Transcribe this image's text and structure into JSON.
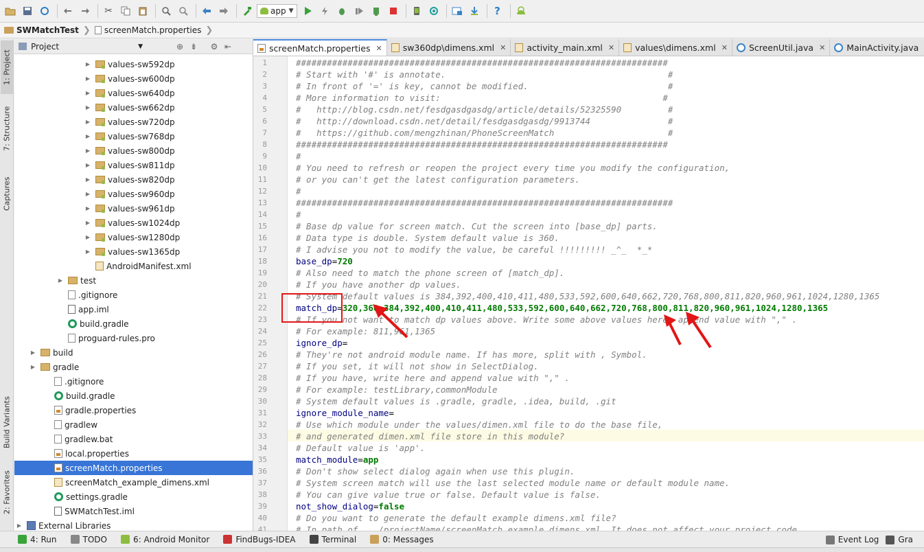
{
  "toolbar": {
    "run_config": "app",
    "icons": [
      "open-folder-icon",
      "save-icon",
      "sync-icon",
      "undo-icon",
      "redo-icon",
      "cut-icon",
      "copy-icon",
      "paste-icon",
      "find-icon",
      "replace-icon",
      "back-icon",
      "forward-icon",
      "build-icon",
      "run-icon",
      "debug-lightning-icon",
      "debug-icon",
      "coverage-icon",
      "profile-icon",
      "stop-icon",
      "avd-manager-icon",
      "sdk-manager-icon",
      "project-structure-icon",
      "sdk-download-icon",
      "help-icon",
      "android-icon"
    ]
  },
  "breadcrumb": {
    "project": "SWMatchTest",
    "file": "screenMatch.properties"
  },
  "left_strip": {
    "tabs": [
      "1: Project",
      "7: Structure",
      "Captures",
      "Build Variants",
      "2: Favorites"
    ]
  },
  "project_panel": {
    "header": "Project",
    "tree": [
      {
        "label": "values-sw592dp",
        "type": "folder-res"
      },
      {
        "label": "values-sw600dp",
        "type": "folder-res"
      },
      {
        "label": "values-sw640dp",
        "type": "folder-res"
      },
      {
        "label": "values-sw662dp",
        "type": "folder-res"
      },
      {
        "label": "values-sw720dp",
        "type": "folder-res"
      },
      {
        "label": "values-sw768dp",
        "type": "folder-res"
      },
      {
        "label": "values-sw800dp",
        "type": "folder-res"
      },
      {
        "label": "values-sw811dp",
        "type": "folder-res"
      },
      {
        "label": "values-sw820dp",
        "type": "folder-res"
      },
      {
        "label": "values-sw960dp",
        "type": "folder-res"
      },
      {
        "label": "values-sw961dp",
        "type": "folder-res"
      },
      {
        "label": "values-sw1024dp",
        "type": "folder-res"
      },
      {
        "label": "values-sw1280dp",
        "type": "folder-res"
      },
      {
        "label": "values-sw1365dp",
        "type": "folder-res"
      },
      {
        "label": "AndroidManifest.xml",
        "type": "manifest"
      },
      {
        "label": "test",
        "type": "folder"
      },
      {
        "label": ".gitignore",
        "type": "file"
      },
      {
        "label": "app.iml",
        "type": "iml"
      },
      {
        "label": "build.gradle",
        "type": "gradle"
      },
      {
        "label": "proguard-rules.pro",
        "type": "file"
      },
      {
        "label": "build",
        "type": "folder"
      },
      {
        "label": "gradle",
        "type": "folder"
      },
      {
        "label": ".gitignore",
        "type": "file"
      },
      {
        "label": "build.gradle",
        "type": "gradle"
      },
      {
        "label": "gradle.properties",
        "type": "props"
      },
      {
        "label": "gradlew",
        "type": "file"
      },
      {
        "label": "gradlew.bat",
        "type": "file"
      },
      {
        "label": "local.properties",
        "type": "props"
      },
      {
        "label": "screenMatch.properties",
        "type": "props"
      },
      {
        "label": "screenMatch_example_dimens.xml",
        "type": "xml"
      },
      {
        "label": "settings.gradle",
        "type": "gradle"
      },
      {
        "label": "SWMatchTest.iml",
        "type": "iml"
      },
      {
        "label": "External Libraries",
        "type": "libs"
      }
    ]
  },
  "editor_tabs": [
    {
      "label": "screenMatch.properties",
      "type": "props"
    },
    {
      "label": "sw360dp\\dimens.xml",
      "type": "xml"
    },
    {
      "label": "activity_main.xml",
      "type": "xml"
    },
    {
      "label": "values\\dimens.xml",
      "type": "xml"
    },
    {
      "label": "ScreenUtil.java",
      "type": "java"
    },
    {
      "label": "MainActivity.java",
      "type": "java"
    }
  ],
  "editor": {
    "lines": [
      {
        "kind": "comment",
        "text": "########################################################################"
      },
      {
        "kind": "comment",
        "text": "# Start with '#' is annotate.                                           #"
      },
      {
        "kind": "comment",
        "text": "# In front of '=' is key, cannot be modified.                           #"
      },
      {
        "kind": "comment",
        "text": "# More information to visit:                                           #"
      },
      {
        "kind": "comment",
        "text": "#   http://blog.csdn.net/fesdgasdgasdg/article/details/52325590         #"
      },
      {
        "kind": "comment",
        "text": "#   http://download.csdn.net/detail/fesdgasdgasdg/9913744               #"
      },
      {
        "kind": "comment",
        "text": "#   https://github.com/mengzhinan/PhoneScreenMatch                      #"
      },
      {
        "kind": "comment",
        "text": "########################################################################"
      },
      {
        "kind": "comment",
        "text": "#"
      },
      {
        "kind": "comment",
        "text": "# You need to refresh or reopen the project every time you modify the configuration,"
      },
      {
        "kind": "comment",
        "text": "# or you can't get the latest configuration parameters."
      },
      {
        "kind": "comment",
        "text": "#"
      },
      {
        "kind": "comment",
        "text": "#########################################################################"
      },
      {
        "kind": "comment",
        "text": "#"
      },
      {
        "kind": "comment",
        "text": "# Base dp value for screen match. Cut the screen into [base_dp] parts."
      },
      {
        "kind": "comment",
        "text": "# Data type is double. System default value is 360."
      },
      {
        "kind": "comment",
        "text": "# I advise you not to modify the value, be careful !!!!!!!!! _^_  *_*"
      },
      {
        "kind": "kv",
        "key": "base_dp",
        "value": "720"
      },
      {
        "kind": "comment",
        "text": "# Also need to match the phone screen of [match_dp]."
      },
      {
        "kind": "comment",
        "text": "# If you have another dp values."
      },
      {
        "kind": "comment",
        "text": "# System default values is 384,392,400,410,411,480,533,592,600,640,662,720,768,800,811,820,960,961,1024,1280,1365"
      },
      {
        "kind": "kv",
        "key": "match_dp",
        "value": "320,360,384,392,400,410,411,480,533,592,600,640,662,720,768,800,811,820,960,961,1024,1280,1365"
      },
      {
        "kind": "comment",
        "text": "# If you not want to match dp values above. Write some above values here, append value with \",\" ."
      },
      {
        "kind": "comment",
        "text": "# For example: 811,961,1365"
      },
      {
        "kind": "kv",
        "key": "ignore_dp",
        "value": ""
      },
      {
        "kind": "comment",
        "text": "# They're not android module name. If has more, split with , Symbol."
      },
      {
        "kind": "comment",
        "text": "# If you set, it will not show in SelectDialog."
      },
      {
        "kind": "comment",
        "text": "# If you have, write here and append value with \",\" ."
      },
      {
        "kind": "comment",
        "text": "# For example: testLibrary,commonModule"
      },
      {
        "kind": "comment",
        "text": "# System default values is .gradle, gradle, .idea, build, .git"
      },
      {
        "kind": "kv",
        "key": "ignore_module_name",
        "value": ""
      },
      {
        "kind": "comment",
        "text": "# Use which module under the values/dimen.xml file to do the base file,"
      },
      {
        "kind": "comment",
        "text": "# and generated dimen.xml file store in this module?"
      },
      {
        "kind": "comment",
        "text": "# Default value is 'app'."
      },
      {
        "kind": "kv",
        "key": "match_module",
        "value": "app"
      },
      {
        "kind": "comment",
        "text": "# Don't show select dialog again when use this plugin."
      },
      {
        "kind": "comment",
        "text": "# System screen match will use the last selected module name or default module name."
      },
      {
        "kind": "comment",
        "text": "# You can give value true or false. Default value is false."
      },
      {
        "kind": "kv",
        "key": "not_show_dialog",
        "value": "false"
      },
      {
        "kind": "comment",
        "text": "# Do you want to generate the default example dimens.xml file?"
      },
      {
        "kind": "comment",
        "text": "# In path of .../projectName/screenMatch_example_dimens.xml, It does not affect your project code."
      }
    ]
  },
  "bottom_bar": {
    "items": [
      {
        "label": "4: Run",
        "icon": "run-icon"
      },
      {
        "label": "TODO",
        "icon": "todo-icon"
      },
      {
        "label": "6: Android Monitor",
        "icon": "android-icon"
      },
      {
        "label": "FindBugs-IDEA",
        "icon": "bug-icon"
      },
      {
        "label": "Terminal",
        "icon": "terminal-icon"
      },
      {
        "label": "0: Messages",
        "icon": "messages-icon"
      }
    ],
    "right_items": [
      {
        "label": "Event Log",
        "icon": "event-log-icon"
      },
      {
        "label": "Gra",
        "icon": "gradle-console-icon"
      }
    ]
  },
  "colors": {
    "accent": "#3875d7",
    "annotation_red": "#e21616",
    "comment": "#808080",
    "key": "#000080",
    "value": "#007a00"
  }
}
